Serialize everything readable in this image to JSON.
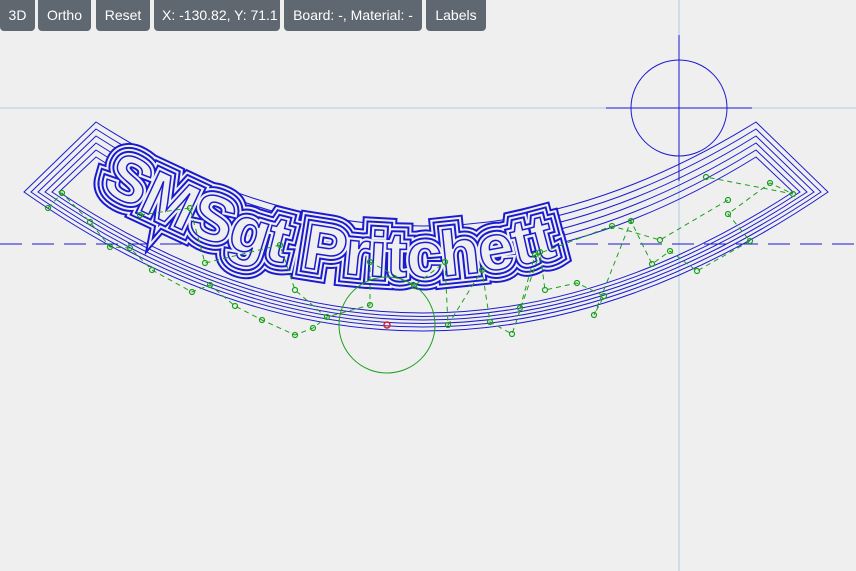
{
  "toolbar": {
    "btn_3d": "3D",
    "btn_ortho": "Ortho",
    "btn_reset": "Reset",
    "coords": "X: -130.82, Y: 71.1",
    "board_material": "Board: -, Material: -",
    "btn_labels": "Labels"
  },
  "colors": {
    "background": "#efefef",
    "button_bg": "#5f6770",
    "button_text": "#ffffff",
    "toolpath": "#1a1ad0",
    "rapid_moves": "#1aa01a",
    "axis_lines": "#a8cde0",
    "cursor_crosshair": "#1a1ad0",
    "start_marker": "#e02020"
  },
  "icons": {
    "cursor": "crosshair-circle-icon",
    "start": "red-start-point-icon"
  },
  "design": {
    "text": "SMSgt Pritchett"
  }
}
